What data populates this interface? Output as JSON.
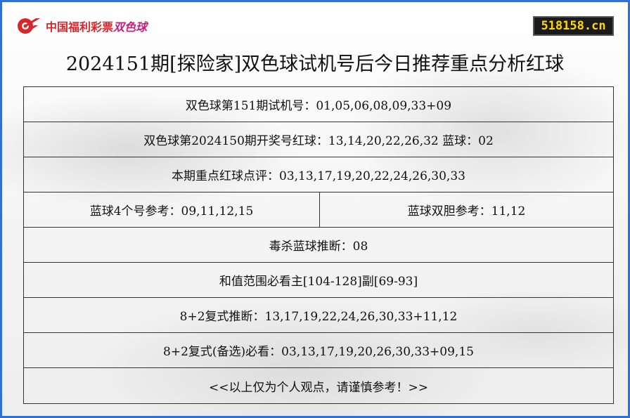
{
  "header": {
    "logo_text": "中国福利彩票",
    "logo_sub": "双色球",
    "site": "518158.cn"
  },
  "title": "2024151期[探险家]双色球试机号后今日推荐重点分析红球",
  "rows": [
    {
      "text": "双色球第151期试机号：01,05,06,08,09,33+09"
    },
    {
      "text": "双色球第2024150期开奖号红球：13,14,20,22,26,32 蓝球：02"
    },
    {
      "text": "本期重点红球点评：03,13,17,19,20,22,24,26,30,33"
    },
    {
      "left": "蓝球4个号参考：09,11,12,15",
      "right": "蓝球双胆参考：11,12"
    },
    {
      "text": "毒杀蓝球推断：08"
    },
    {
      "text": "和值范围必看主[104-128]副[69-93]"
    },
    {
      "text": "8+2复式推断：13,17,19,22,24,26,30,33+11,12"
    },
    {
      "text": "8+2复式(备选)必看：03,13,17,19,20,26,30,33+09,15"
    },
    {
      "text": "<<以上仅为个人观点，请谨慎参考！>>"
    }
  ],
  "colors": {
    "frame_border": "#2f6fd6",
    "logo_red": "#d8262b",
    "logo_ssq": "#c81f7a",
    "badge_bg": "#1a1a1a",
    "badge_text": "#ffd800"
  }
}
